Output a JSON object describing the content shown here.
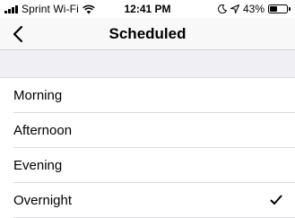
{
  "status_bar": {
    "carrier": "Sprint Wi-Fi",
    "time": "12:41 PM",
    "battery_text": "43%",
    "battery_level": 0.43,
    "icons": [
      "signal-icon",
      "wifi-icon",
      "moon-icon",
      "location-arrow-icon",
      "battery-icon"
    ]
  },
  "nav": {
    "title": "Scheduled",
    "back_icon": "chevron-left-icon"
  },
  "options": [
    {
      "label": "Morning",
      "selected": false
    },
    {
      "label": "Afternoon",
      "selected": false
    },
    {
      "label": "Evening",
      "selected": false
    },
    {
      "label": "Overnight",
      "selected": true
    }
  ],
  "colors": {
    "accent": "#000000",
    "group_background": "#efeff4",
    "separator": "#dcdce0"
  }
}
